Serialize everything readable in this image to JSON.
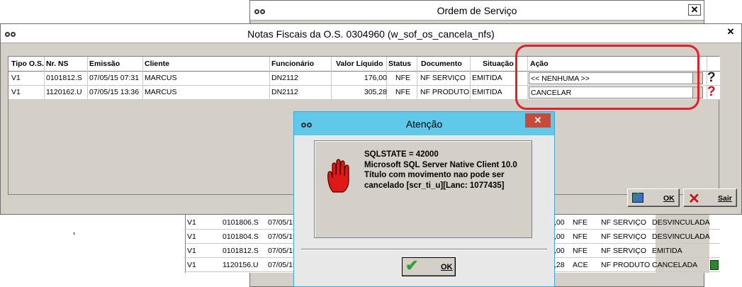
{
  "background_window": {
    "title": "Ordem de Serviço",
    "rows": [
      {
        "tipo": "V1",
        "nr": "0101806.S",
        "emissao": "07/05/15",
        "valor": ",00",
        "status": "NFE",
        "documento": "NF SERVIÇO",
        "situacao": "DESVINCULADA"
      },
      {
        "tipo": "V1",
        "nr": "0101804.S",
        "emissao": "07/05/15",
        "valor": ",00",
        "status": "NFE",
        "documento": "NF SERVIÇO",
        "situacao": "DESVINCULADA"
      },
      {
        "tipo": "V1",
        "nr": "0101812.S",
        "emissao": "07/05/15",
        "valor": ",00",
        "status": "NFE",
        "documento": "NF SERVIÇO",
        "situacao": "EMITIDA"
      },
      {
        "tipo": "V1",
        "nr": "1120156.U",
        "emissao": "07/05/15",
        "valor": ",28",
        "status": "ACE",
        "documento": "NF PRODUTO",
        "situacao": "CANCELADA"
      }
    ]
  },
  "main_window": {
    "title": "Notas Fiscais da O.S. 0304960 (w_sof_os_cancela_nfs)",
    "headers": {
      "tipo": "Tipo O.S.",
      "nr": "Nr. NS",
      "emissao": "Emissão",
      "cliente": "Cliente",
      "funcionario": "Funcionário",
      "valor": "Valor Líquido",
      "status": "Status",
      "documento": "Documento",
      "situacao": "Situação",
      "acao": "Ação"
    },
    "rows": [
      {
        "tipo": "V1",
        "nr": "0101812.S",
        "emissao": "07/05/15 07:31",
        "cliente": "MARCUS",
        "funcionario": "DN2112",
        "valor": "176,00",
        "status": "NFE",
        "documento": "NF SERVIÇO",
        "situacao": "EMITIDA",
        "acao": "<< NENHUMA >>"
      },
      {
        "tipo": "V1",
        "nr": "1120162.U",
        "emissao": "07/05/15 13:36",
        "cliente": "MARCUS",
        "funcionario": "DN2112",
        "valor": "305,28",
        "status": "NFE",
        "documento": "NF PRODUTO",
        "situacao": "EMITIDA",
        "acao": "CANCELAR"
      }
    ],
    "ok_label": "OK",
    "exit_label": "Sair"
  },
  "dialog": {
    "title": "Atenção",
    "message_lines": [
      "SQLSTATE = 42000",
      "Microsoft SQL Server Native Client 10.0",
      "Título com movimento nao pode ser",
      "cancelado [scr_ti_u][Lanc: 1077435]"
    ],
    "ok_label": "OK"
  },
  "colors": {
    "dialog_title": "#60c8e8",
    "highlight": "#e0202a",
    "window_bg": "#d4d0c8"
  }
}
